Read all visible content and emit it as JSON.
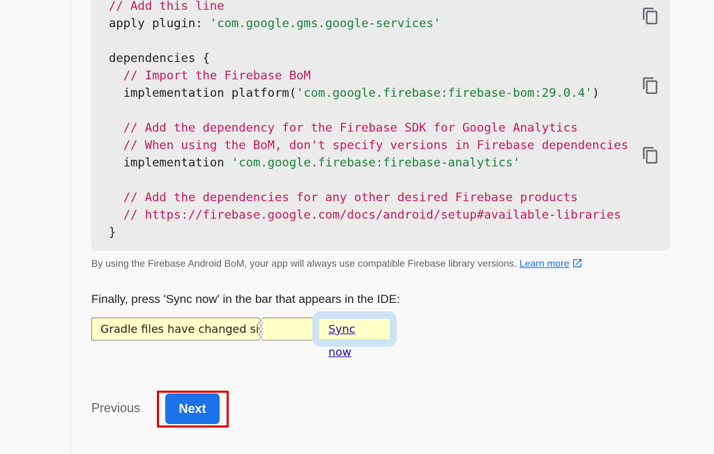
{
  "code": {
    "lines": [
      {
        "parts": [
          {
            "t": "// Add this line",
            "c": "comment"
          }
        ]
      },
      {
        "parts": [
          {
            "t": "apply plugin",
            "c": "plain"
          },
          {
            "t": ": ",
            "c": "plain"
          },
          {
            "t": "'com.google.gms.google-services'",
            "c": "str"
          }
        ]
      },
      {
        "parts": [
          {
            "t": "",
            "c": "plain"
          }
        ]
      },
      {
        "parts": [
          {
            "t": "dependencies {",
            "c": "plain"
          }
        ]
      },
      {
        "parts": [
          {
            "t": "  // Import the Firebase BoM",
            "c": "comment"
          }
        ]
      },
      {
        "parts": [
          {
            "t": "  implementation platform(",
            "c": "plain"
          },
          {
            "t": "'com.google.firebase:firebase-bom:29.0.4'",
            "c": "str"
          },
          {
            "t": ")",
            "c": "plain"
          }
        ]
      },
      {
        "parts": [
          {
            "t": "",
            "c": "plain"
          }
        ]
      },
      {
        "parts": [
          {
            "t": "  // Add the dependency for the Firebase SDK for Google Analytics",
            "c": "comment"
          }
        ]
      },
      {
        "parts": [
          {
            "t": "  // When using the BoM, don't specify versions in Firebase dependencies",
            "c": "comment"
          }
        ]
      },
      {
        "parts": [
          {
            "t": "  implementation ",
            "c": "plain"
          },
          {
            "t": "'com.google.firebase:firebase-analytics'",
            "c": "str"
          }
        ]
      },
      {
        "parts": [
          {
            "t": "",
            "c": "plain"
          }
        ]
      },
      {
        "parts": [
          {
            "t": "  // Add the dependencies for any other desired Firebase products",
            "c": "comment"
          }
        ]
      },
      {
        "parts": [
          {
            "t": "  // https://firebase.google.com/docs/android/setup#available-libraries",
            "c": "comment"
          }
        ]
      },
      {
        "parts": [
          {
            "t": "}",
            "c": "plain"
          }
        ]
      }
    ],
    "copy_icon": "copy-icon"
  },
  "note": {
    "text": "By using the Firebase Android BoM, your app will always use compatible Firebase library versions.",
    "link_label": "Learn more",
    "link_icon": "external-link-icon"
  },
  "instruction": "Finally, press 'Sync now' in the bar that appears in the IDE:",
  "ide_bar": {
    "message": "Gradle files have changed since last project sync",
    "sync_label": "Sync now"
  },
  "nav": {
    "previous_label": "Previous",
    "next_label": "Next"
  },
  "colors": {
    "accent": "#1a73e8",
    "highlight_border": "#e00000",
    "comment": "#c2185b",
    "string": "#188038",
    "ide_bar_bg": "#ffffc8"
  }
}
